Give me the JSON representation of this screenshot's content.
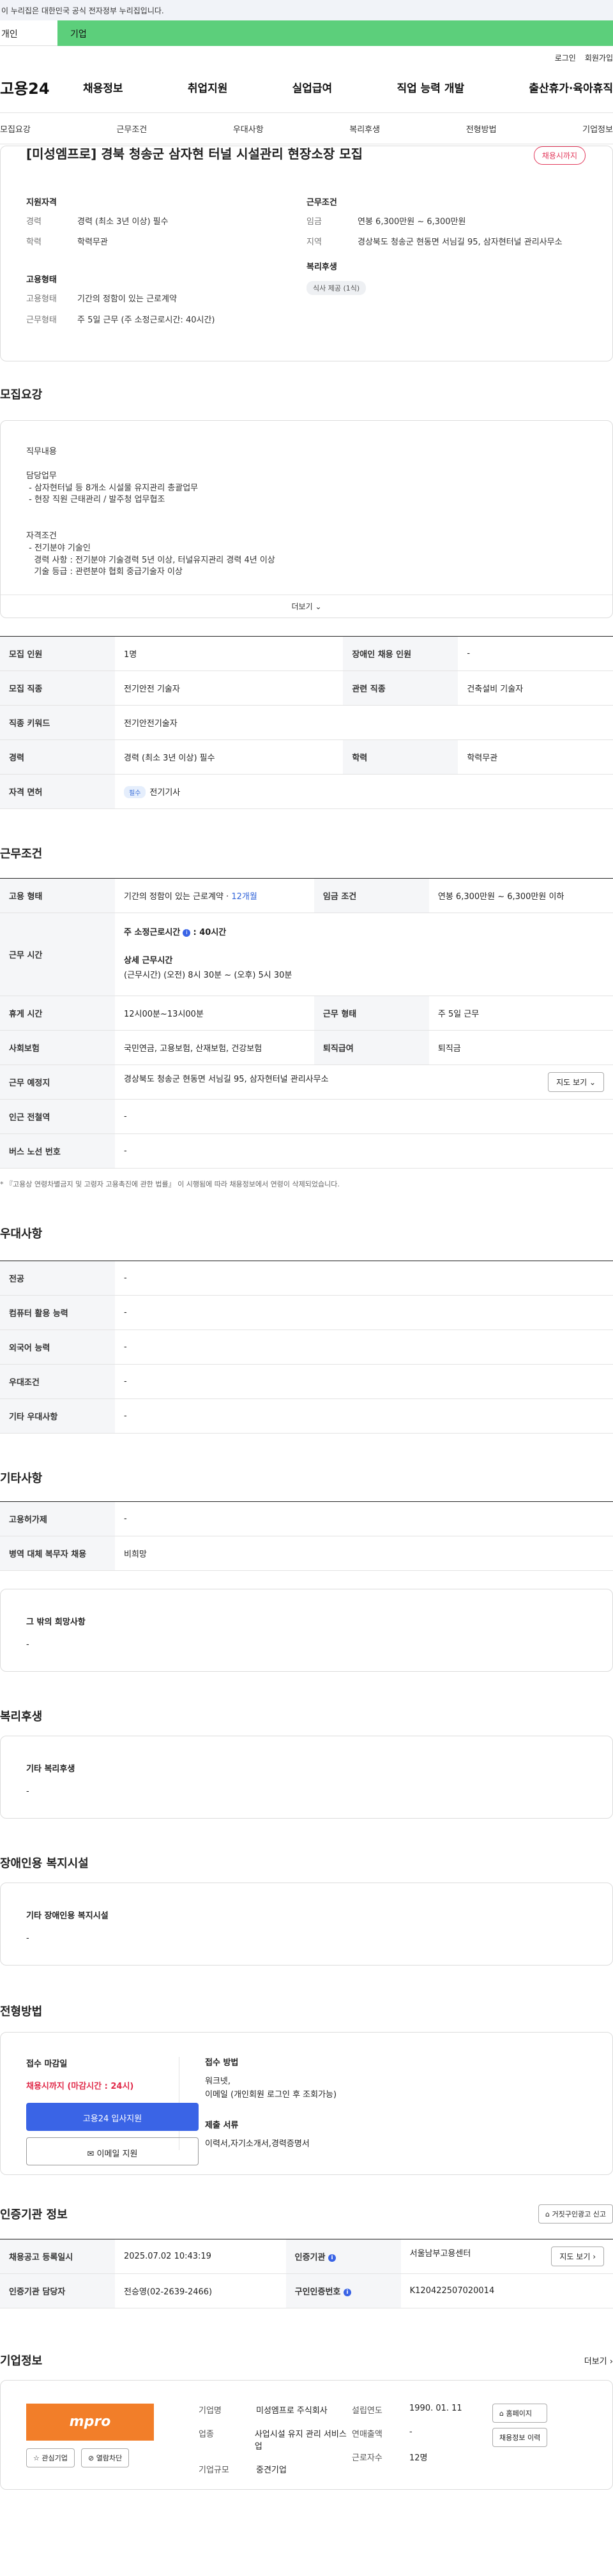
{
  "gov_banner": "이 누리집은 대한민국 공식 전자정부 누리집입니다.",
  "tabs": {
    "person": "개인",
    "corp": "기업"
  },
  "util": {
    "login": "로그인",
    "join": "회원가입"
  },
  "gnb": {
    "logo": "고용24",
    "menus": [
      "채용정보",
      "취업지원",
      "실업급여",
      "직업 능력 개발",
      "출산휴가·육아휴직"
    ]
  },
  "subnav": [
    "모집요강",
    "근무조건",
    "우대사항",
    "복리후생",
    "전형방법",
    "기업정보"
  ],
  "summary": {
    "title": "[미성엠프로] 경북 청송군 삼자현 터널 시설관리 현장소장 모집",
    "status": "채용시까지",
    "qual_title": "지원자격",
    "qual": [
      {
        "k": "경력",
        "v": "경력 (최소 3년 이상) 필수"
      },
      {
        "k": "학력",
        "v": "학력무관"
      }
    ],
    "emp_title": "고용형태",
    "emp": [
      {
        "k": "고용형태",
        "v": "기간의 정함이 있는 근로계약"
      },
      {
        "k": "근무형태",
        "v": "주 5일 근무 (주 소정근로시간: 40시간)"
      }
    ],
    "cond_title": "근무조건",
    "cond": [
      {
        "k": "임금",
        "v": "연봉 6,300만원 ~ 6,300만원"
      },
      {
        "k": "지역",
        "v": "경상북도 청송군 현동면 서님길 95, 삼자현터널 관리사무소"
      }
    ],
    "welfare_title": "복리후생",
    "welfare_tag": "식사 제공 (1식)"
  },
  "recruit": {
    "title": "모집요강",
    "desc_lines": [
      "직무내용",
      "",
      "담당업무",
      " - 삼자현터널 등 8개소 시설물 유지관리 총괄업무",
      " - 현장 직원 근태관리 / 발주청 업무협조",
      "",
      "",
      "자격조건",
      " - 전기분야 기술인",
      "   경력 사항 : 전기분야 기술경력 5년 이상, 터널유지관리 경력 4년 이상",
      "   기술 등급 : 관련분야 협회 중급기술자 이상"
    ],
    "more": "더보기",
    "table": {
      "headcount_k": "모집 인원",
      "headcount_v": "1명",
      "disabled_k": "장애인 채용 인원",
      "disabled_v": "-",
      "job_k": "모집 직종",
      "job_v": "전기안전 기술자",
      "rel_k": "관련 직종",
      "rel_v": "건축설비 기술자",
      "kw_k": "직종 키워드",
      "kw_v": "전기안전기술자",
      "career_k": "경력",
      "career_v": "경력 (최소 3년 이상) 필수",
      "edu_k": "학력",
      "edu_v": "학력무관",
      "license_k": "자격 면허",
      "license_tag": "필수",
      "license_v": "전기기사"
    }
  },
  "work": {
    "title": "근무조건",
    "emp_k": "고용 형태",
    "emp_v": "기간의 정함이 있는 근로계약 · ",
    "emp_months": "12개월",
    "wage_k": "임금 조건",
    "wage_v": "연봉 6,300만원 ~ 6,300만원 이하",
    "time_k": "근무 시간",
    "time_main": "주 소정근로시간",
    "time_main_v": ": 40시간",
    "time_detail_t": "상세 근무시간",
    "time_detail": "(근무시간) (오전) 8시 30분 ~ (오후) 5시 30분",
    "rest_k": "휴게 시간",
    "rest_v": "12시00분~13시00분",
    "form_k": "근무 형태",
    "form_v": "주 5일 근무",
    "ins_k": "사회보험",
    "ins_v": "국민연금, 고용보험, 산재보험, 건강보험",
    "sev_k": "퇴직급여",
    "sev_v": "퇴직금",
    "place_k": "근무 예정지",
    "place_v": "경상북도 청송군 현동면 서님길 95, 삼자현터널 관리사무소",
    "map_btn": "지도 보기",
    "sub_k": "인근 전철역",
    "sub_v": "-",
    "bus_k": "버스 노선 번호",
    "bus_v": "-",
    "note": "* 『고용상 연령차별금지 및 고령자 고용촉진에 관한 법률』 이 시행됨에 따라 채용정보에서 연령이 삭제되었습니다."
  },
  "pref": {
    "title": "우대사항",
    "rows": [
      {
        "k": "전공",
        "v": "-"
      },
      {
        "k": "컴퓨터 활용 능력",
        "v": "-"
      },
      {
        "k": "외국어 능력",
        "v": "-"
      },
      {
        "k": "우대조건",
        "v": "-"
      },
      {
        "k": "기타 우대사항",
        "v": "-"
      }
    ]
  },
  "etc": {
    "title": "기타사항",
    "rows": [
      {
        "k": "고용허가제",
        "v": "-"
      },
      {
        "k": "병역 대체 복무자 채용",
        "v": "비희망"
      }
    ],
    "other_t": "그 밖의 희망사항",
    "other_v": "-"
  },
  "welfare": {
    "title": "복리후생",
    "box_t": "기타 복리후생",
    "box_v": "-"
  },
  "disabled": {
    "title": "장애인용 복지시설",
    "box_t": "기타 장애인용 복지시설",
    "box_v": "-"
  },
  "screening": {
    "title": "전형방법",
    "deadline_t": "접수 마감일",
    "deadline_v": "채용시까지 (마감시간 : 24시)",
    "btn_apply": "고용24 입사지원",
    "btn_email": "이메일 지원",
    "method_t": "접수 방법",
    "method_v1": "워크넷,",
    "method_v2": "이메일 (개인회원 로그인 후 조회가능)",
    "docs_t": "제출 서류",
    "docs_v": "이력서,자기소개서,경력증명서"
  },
  "agency": {
    "title": "인증기관 정보",
    "report_btn": "거짓구인광고 신고",
    "reg_k": "채용공고 등록일시",
    "reg_v": "2025.07.02 10:43:19",
    "org_k": "인증기관",
    "org_v": "서울남부고용센터",
    "org_btn": "지도 보기",
    "mgr_k": "인증기관 담당자",
    "mgr_v": "전승영(02-2639-2466)",
    "no_k": "구인인증번호",
    "no_v": "K120422507020014"
  },
  "corp": {
    "title": "기업정보",
    "more": "더보기",
    "logo": "mpro",
    "btn_fav": "관심기업",
    "btn_block": "열람차단",
    "name_k": "기업명",
    "name_v": "미성엠프로 주식회사",
    "ind_k": "업종",
    "ind_v": "사업시설 유지 관리 서비스업",
    "scale_k": "기업규모",
    "scale_v": "중견기업",
    "est_k": "설립연도",
    "est_v": "1990. 01. 11",
    "sales_k": "연매출액",
    "sales_v": "-",
    "emp_k": "근로자수",
    "emp_v": "12명",
    "btn_home": "홈페이지",
    "btn_list": "채용정보 이력"
  }
}
